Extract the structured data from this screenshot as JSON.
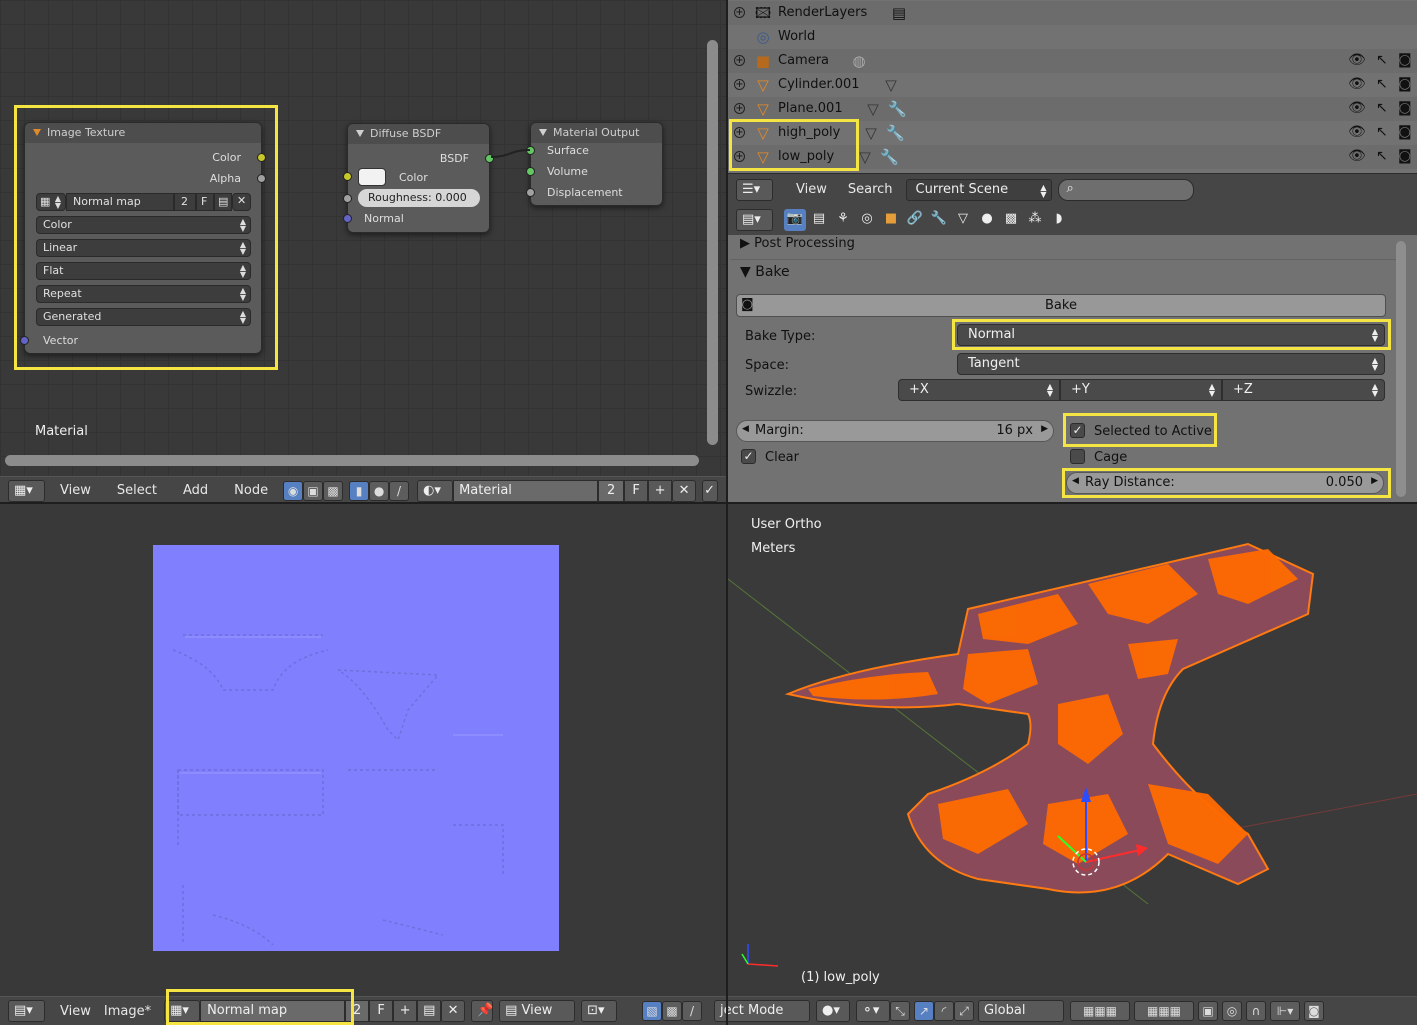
{
  "node_editor": {
    "image_texture": {
      "title": "Image Texture",
      "outputs": [
        "Color",
        "Alpha"
      ],
      "image_name": "Normal map",
      "users": "2",
      "fake": "F",
      "color_space": "Color",
      "interpolation": "Linear",
      "projection": "Flat",
      "extension": "Repeat",
      "source": "Generated",
      "input": "Vector"
    },
    "diffuse": {
      "title": "Diffuse BSDF",
      "output": "BSDF",
      "color_label": "Color",
      "roughness": "Roughness:  0.000",
      "normal_label": "Normal"
    },
    "material_output": {
      "title": "Material Output",
      "inputs": [
        "Surface",
        "Volume",
        "Displacement"
      ]
    },
    "material_label": "Material",
    "header": {
      "menus": [
        "View",
        "Select",
        "Add",
        "Node"
      ],
      "material_name": "Material",
      "users": "2",
      "fake": "F"
    }
  },
  "outliner": {
    "rows": [
      {
        "label": "RenderLayers",
        "icon": "renderlayers-icon"
      },
      {
        "label": "World",
        "icon": "world-icon"
      },
      {
        "label": "Camera",
        "icon": "camera-icon"
      },
      {
        "label": "Cylinder.001",
        "icon": "mesh-icon"
      },
      {
        "label": "Plane.001",
        "icon": "mesh-icon"
      },
      {
        "label": "high_poly",
        "icon": "mesh-icon"
      },
      {
        "label": "low_poly",
        "icon": "mesh-icon"
      }
    ],
    "header": {
      "menus": [
        "View",
        "Search"
      ],
      "scene_select": "Current Scene",
      "search_placeholder": ""
    }
  },
  "properties": {
    "post_processing": "Post Processing",
    "bake_panel": "Bake",
    "bake_button": "Bake",
    "bake_type_label": "Bake Type:",
    "bake_type": "Normal",
    "space_label": "Space:",
    "space": "Tangent",
    "swizzle_label": "Swizzle:",
    "swizzle": [
      "+X",
      "+Y",
      "+Z"
    ],
    "margin_label": "Margin:",
    "margin_value": "16 px",
    "selected_to_active": "Selected to Active",
    "selected_to_active_checked": true,
    "clear": "Clear",
    "clear_checked": true,
    "cage": "Cage",
    "cage_checked": false,
    "ray_distance_label": "Ray Distance:",
    "ray_distance_value": "0.050"
  },
  "image_editor": {
    "header": {
      "menus": [
        "View",
        "Image*"
      ],
      "image_name": "Normal map",
      "users": "2",
      "fake": "F",
      "view_select": "View"
    }
  },
  "viewport": {
    "view_name": "User Ortho",
    "units": "Meters",
    "object_label": "(1) low_poly",
    "header": {
      "mode": "ject Mode",
      "orientation": "Global"
    }
  },
  "colors": {
    "highlight": "#f4e542",
    "normal_map": "#8080ff",
    "selection_orange": "#ff6a00",
    "mesh_surface": "#8a4a5a"
  }
}
